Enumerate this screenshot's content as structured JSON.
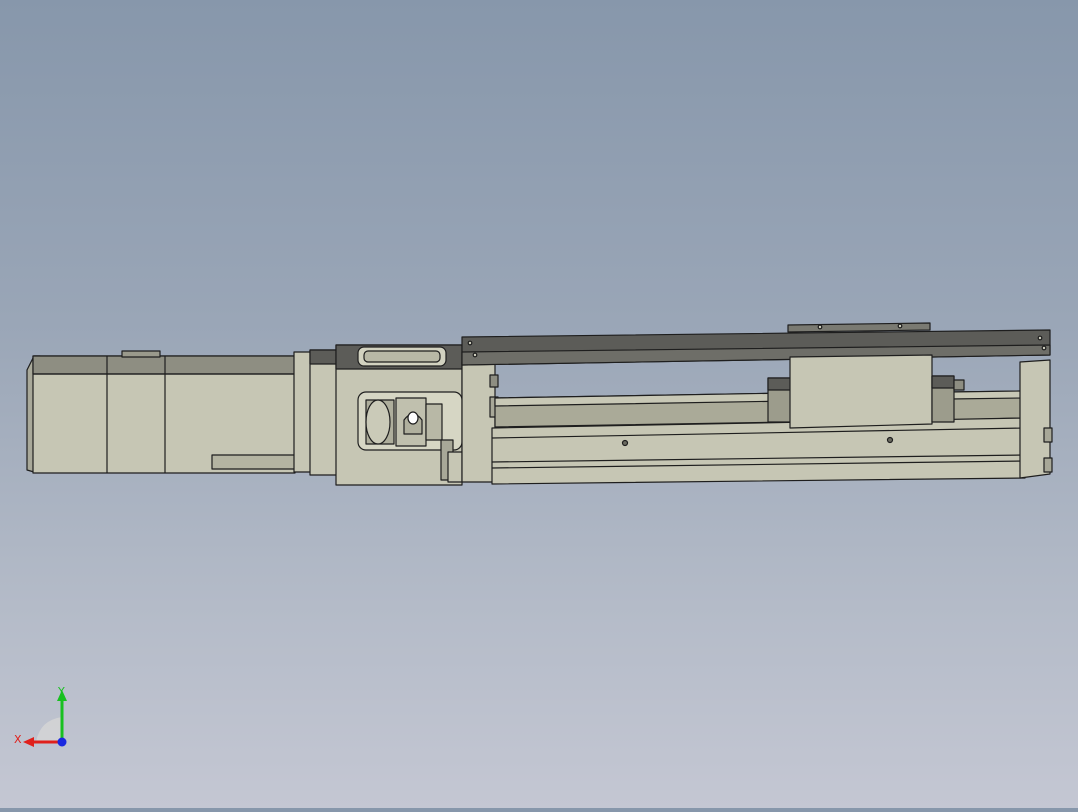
{
  "viewport": {
    "background_top": "#8797ab",
    "background_bottom": "#c4c7d3",
    "model_body_color": "#c6c6b4",
    "model_dark_color": "#5c5c58",
    "edge_color": "#1e1e1e"
  },
  "triad": {
    "x_label": "X",
    "y_label": "Y",
    "x_color": "#e0201c",
    "y_color": "#18c020",
    "z_color": "#1a28e0"
  }
}
